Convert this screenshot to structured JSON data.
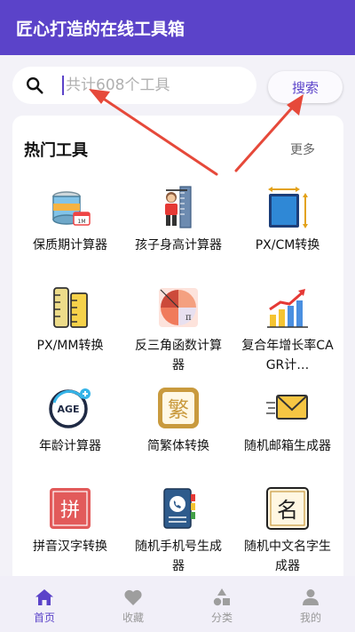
{
  "app": {
    "title": "匠心打造的在线工具箱"
  },
  "search": {
    "placeholder": "共计608个工具",
    "button_label": "搜索"
  },
  "hot": {
    "title": "热门工具",
    "more_label": "更多"
  },
  "tools": [
    {
      "label": "保质期计算器",
      "icon": "canned-food-expiry-icon"
    },
    {
      "label": "孩子身高计算器",
      "icon": "child-height-icon"
    },
    {
      "label": "PX/CM转换",
      "icon": "px-cm-ruler-icon"
    },
    {
      "label": "PX/MM转换",
      "icon": "px-mm-ruler-icon"
    },
    {
      "label": "反三角函数计算器",
      "icon": "trig-pie-icon"
    },
    {
      "label": "复合年增长率CAGR计…",
      "icon": "growth-chart-icon"
    },
    {
      "label": "年龄计算器",
      "icon": "age-icon"
    },
    {
      "label": "简繁体转换",
      "icon": "traditional-char-icon"
    },
    {
      "label": "随机邮箱生成器",
      "icon": "envelope-icon"
    },
    {
      "label": "拼音汉字转换",
      "icon": "pinyin-stamp-icon"
    },
    {
      "label": "随机手机号生成器",
      "icon": "phone-book-icon"
    },
    {
      "label": "随机中文名字生成器",
      "icon": "chinese-name-icon"
    }
  ],
  "nav": [
    {
      "label": "首页",
      "icon": "home-icon",
      "active": true
    },
    {
      "label": "收藏",
      "icon": "heart-icon"
    },
    {
      "label": "分类",
      "icon": "category-icon"
    },
    {
      "label": "我的",
      "icon": "user-icon"
    }
  ],
  "colors": {
    "primary": "#5b43c9",
    "annotation": "#e6493a"
  }
}
